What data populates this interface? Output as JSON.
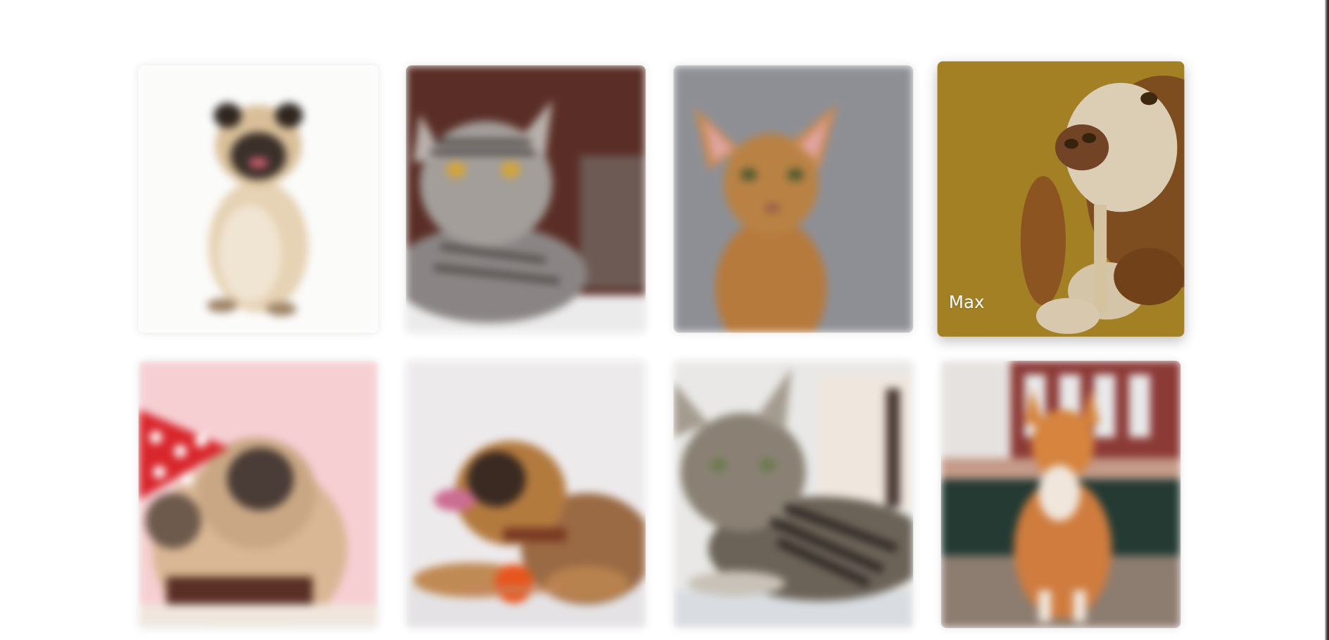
{
  "gallery": {
    "cards": [
      {
        "animal": "pug-dog",
        "state": "blurred",
        "label": ""
      },
      {
        "animal": "silver-tabby-cat",
        "state": "blurred",
        "label": ""
      },
      {
        "animal": "abyssinian-cat",
        "state": "blurred",
        "label": ""
      },
      {
        "animal": "basset-hound-dog",
        "state": "focused",
        "label": "Max"
      },
      {
        "animal": "pug-party-hat-dog",
        "state": "blurred",
        "label": ""
      },
      {
        "animal": "puppy-with-ball-dog",
        "state": "blurred",
        "label": ""
      },
      {
        "animal": "tabby-cat-lying",
        "state": "blurred",
        "label": ""
      },
      {
        "animal": "orange-cat-outdoor",
        "state": "blurred",
        "label": ""
      }
    ]
  },
  "colors": {
    "page_background": "#ffffff",
    "label_text": "#ffffff",
    "focused_background": "#a98a2c"
  }
}
